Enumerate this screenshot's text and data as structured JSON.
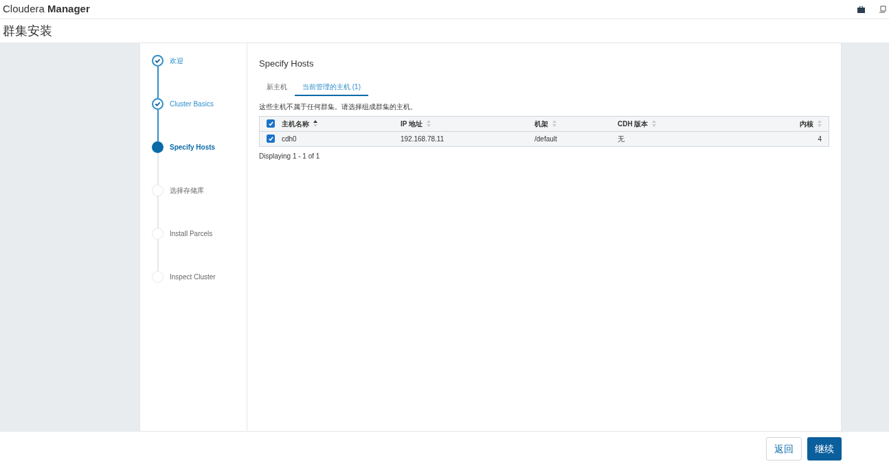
{
  "header": {
    "brand_light": "Cloudera",
    "brand_bold": "Manager"
  },
  "page_title": "群集安装",
  "steps": [
    {
      "label": "欢迎",
      "kind": "done"
    },
    {
      "label": "Cluster Basics",
      "kind": "done"
    },
    {
      "label": "Specify Hosts",
      "kind": "current"
    },
    {
      "label": "选择存储库",
      "kind": "pending"
    },
    {
      "label": "Install Parcels",
      "kind": "pending"
    },
    {
      "label": "Inspect Cluster",
      "kind": "pending"
    }
  ],
  "section_title": "Specify Hosts",
  "tabs": [
    {
      "label": "新主机",
      "selected": false
    },
    {
      "label": "当前管理的主机 (1)",
      "selected": true
    }
  ],
  "description": "这些主机不属于任何群集。请选择组成群集的主机。",
  "table": {
    "all_checked": true,
    "columns": [
      {
        "label": "主机名称",
        "sorted": true
      },
      {
        "label": "IP 地址",
        "sorted": false
      },
      {
        "label": "机架",
        "sorted": false
      },
      {
        "label": "CDH 版本",
        "sorted": false
      },
      {
        "label": "内核",
        "sorted": false
      }
    ],
    "rows": [
      {
        "checked": true,
        "cells": [
          "cdh0",
          "192.168.78.11",
          "/default",
          "无",
          "4"
        ]
      }
    ]
  },
  "pagination": "Displaying 1 - 1 of 1",
  "buttons": {
    "back": "返回",
    "continue": "继续"
  }
}
